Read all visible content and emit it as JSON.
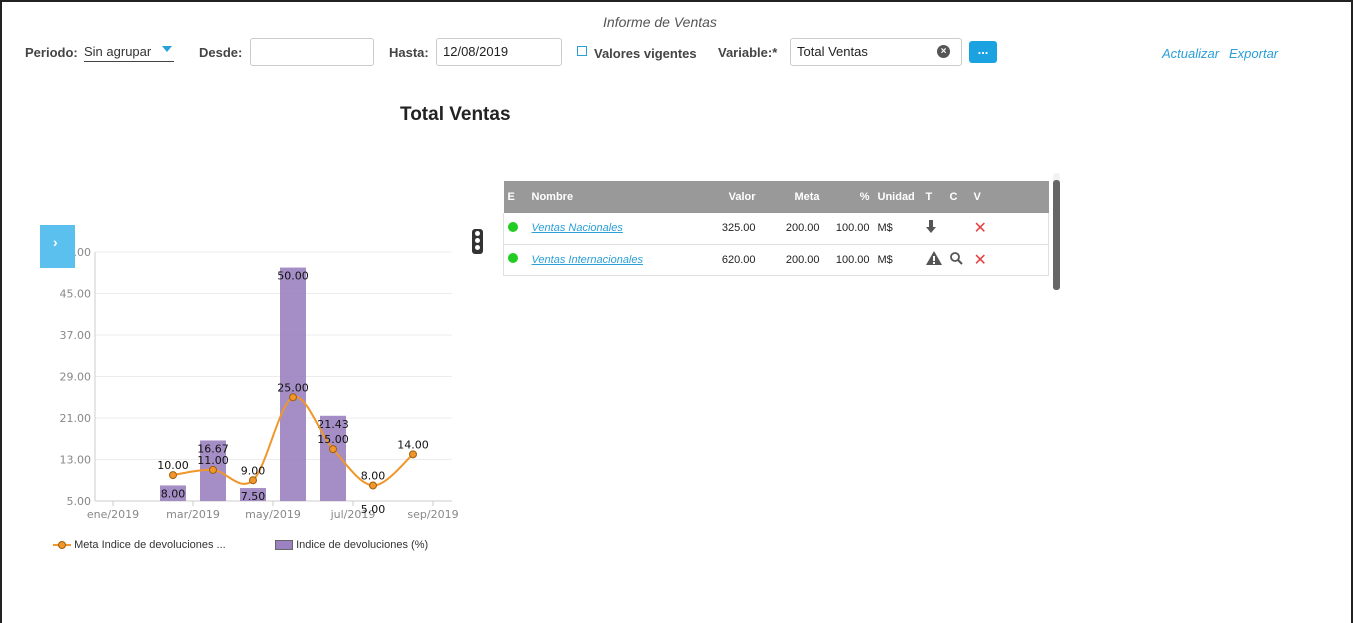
{
  "report_title": "Informe de Ventas",
  "filters": {
    "periodo_label": "Periodo:",
    "periodo_value": "Sin agrupar",
    "desde_label": "Desde:",
    "desde_value": "",
    "hasta_label": "Hasta:",
    "hasta_value": "12/08/2019",
    "valores_vigentes_label": "Valores vigentes",
    "variable_label": "Variable:*",
    "variable_value": "Total Ventas",
    "more_label": "..."
  },
  "actions": {
    "actualizar": "Actualizar",
    "exportar": "Exportar"
  },
  "chart_title": "Total Ventas",
  "side_tab_label": "›",
  "table": {
    "headers": [
      "E",
      "Nombre",
      "Valor",
      "Meta",
      "%",
      "Unidad",
      "T",
      "C",
      "V"
    ],
    "rows": [
      {
        "status_color": "#22cc22",
        "nombre": "Ventas Nacionales",
        "valor": "325.00",
        "meta": "200.00",
        "pct": "100.00",
        "unidad": "M$",
        "trend_icon": "arrow-down-icon",
        "v_icon": "close-icon"
      },
      {
        "status_color": "#22cc22",
        "nombre": "Ventas Internacionales",
        "valor": "620.00",
        "meta": "200.00",
        "pct": "100.00",
        "unidad": "M$",
        "trend_icon": "warning-triangle-icon",
        "c_icon": "search-icon",
        "v_icon": "close-icon"
      }
    ]
  },
  "chart_data": {
    "type": "bar",
    "x_ticks": [
      "ene/2019",
      "mar/2019",
      "may/2019",
      "jul/2019",
      "sep/2019"
    ],
    "y_ticks": [
      5.0,
      13.0,
      21.0,
      29.0,
      37.0,
      45.0,
      53.0
    ],
    "ylim": [
      5,
      53
    ],
    "series": [
      {
        "name": "Indice de devoluciones (%)",
        "type": "bar",
        "color": "#9b82c0",
        "points": [
          {
            "x": "feb/2019",
            "y": 8.0
          },
          {
            "x": "mar/2019",
            "y": 16.67
          },
          {
            "x": "abr/2019",
            "y": 7.5
          },
          {
            "x": "may/2019",
            "y": 50.0
          },
          {
            "x": "jun/2019",
            "y": 21.43
          },
          {
            "x": "jul/2019",
            "y": 5.0
          }
        ]
      },
      {
        "name": "Meta Indice de devoluciones ...",
        "type": "line",
        "color": "#f0962a",
        "points": [
          {
            "x": "feb/2019",
            "y": 10.0
          },
          {
            "x": "mar/2019",
            "y": 11.0
          },
          {
            "x": "abr/2019",
            "y": 9.0
          },
          {
            "x": "may/2019",
            "y": 25.0
          },
          {
            "x": "jun/2019",
            "y": 15.0
          },
          {
            "x": "jul/2019",
            "y": 8.0
          },
          {
            "x": "ago/2019",
            "y": 14.0
          }
        ]
      }
    ]
  }
}
